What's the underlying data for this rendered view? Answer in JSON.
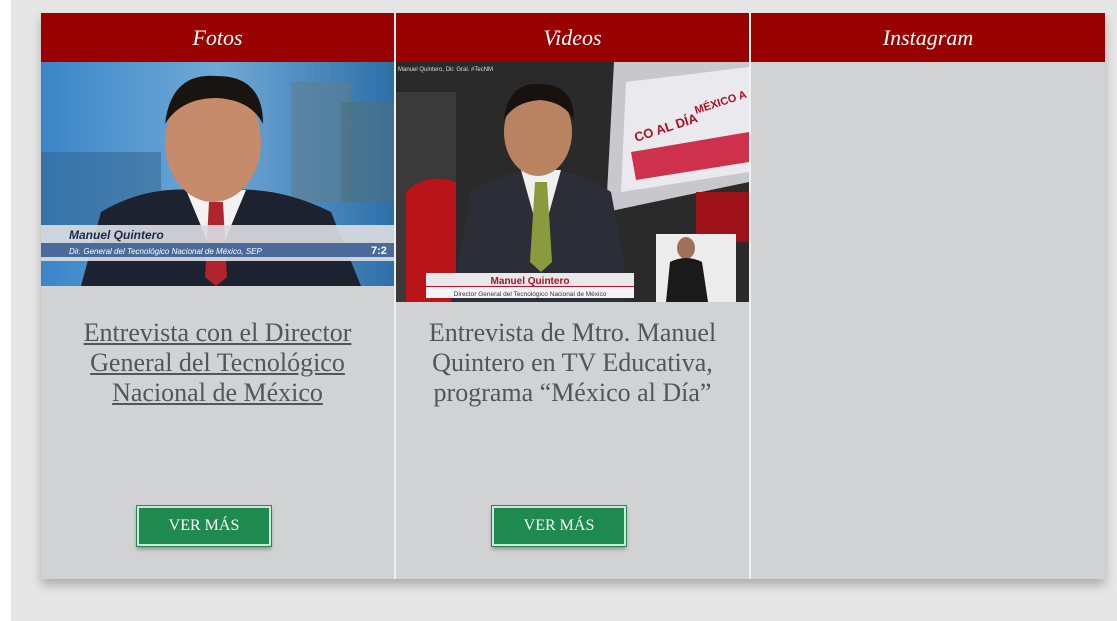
{
  "columns": [
    {
      "header": "Fotos",
      "image": {
        "lower_third_name": "Manuel Quintero",
        "lower_third_title": "Dir. General del Tecnológico Nacional de México, SEP",
        "clock": "7:2"
      },
      "caption": "Entrevista con el Director General del Tecnológico Nacional de México",
      "button": "VER MÁS"
    },
    {
      "header": "Videos",
      "image": {
        "top_label": "Manuel Quintero, Dir. Gral. #TecNM",
        "screen_text_1": "CO AL DÍA",
        "screen_text_2": "MÉXICO A",
        "lower_third_name": "Manuel Quintero",
        "lower_third_title": "Director General del Tecnológico Nacional de México"
      },
      "caption": "Entrevista de Mtro. Manuel Quintero en TV Educativa, programa “México al Día”",
      "button": "VER MÁS"
    },
    {
      "header": "Instagram"
    }
  ],
  "colors": {
    "header_bg": "#990000",
    "panel_bg": "#d1d2d4",
    "button_bg": "#1f8a4f"
  }
}
